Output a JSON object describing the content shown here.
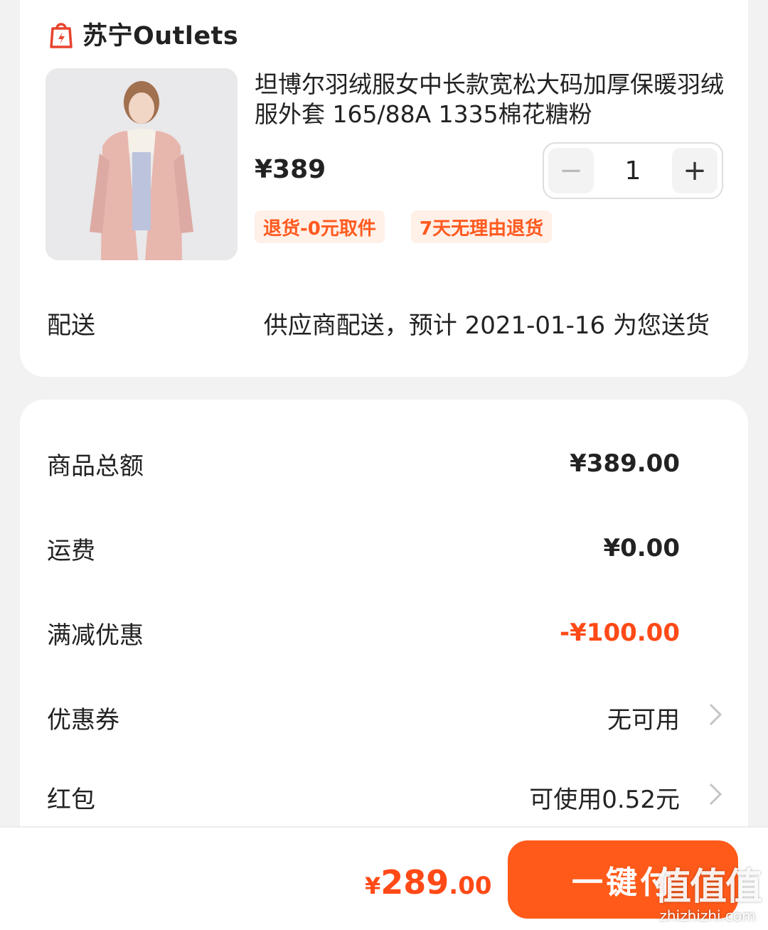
{
  "store": {
    "name": "苏宁Outlets",
    "logo_icon": "suning-bag-icon",
    "brand_color": "#e8432e"
  },
  "product": {
    "title": "坦博尔羽绒服女中长款宽松大码加厚保暖羽绒服外套 165/88A 1335棉花糖粉",
    "price": "¥389",
    "quantity": "1",
    "minus_label": "−",
    "plus_label": "+",
    "tags": [
      "退货-0元取件",
      "7天无理由退货"
    ]
  },
  "delivery": {
    "label": "配送",
    "value": "供应商配送，预计 2021-01-16 为您送货"
  },
  "fees": [
    {
      "label": "商品总额",
      "value": "¥389.00"
    },
    {
      "label": "运费",
      "value": "¥0.00"
    },
    {
      "label": "满减优惠",
      "value": "-¥100.00"
    },
    {
      "label": "优惠券",
      "value": "无可用"
    },
    {
      "label": "红包",
      "value": "可使用0.52元"
    }
  ],
  "footer": {
    "total_currency": "¥",
    "total_integer": "289",
    "total_decimal": ".00",
    "pay_button": "一键付",
    "watermark": "值值值",
    "watermark_url": "zhizhizhi.com"
  },
  "colors": {
    "accent": "#ff5a1a",
    "discount": "#ff4a17",
    "tag_bg": "#fff0e8"
  }
}
